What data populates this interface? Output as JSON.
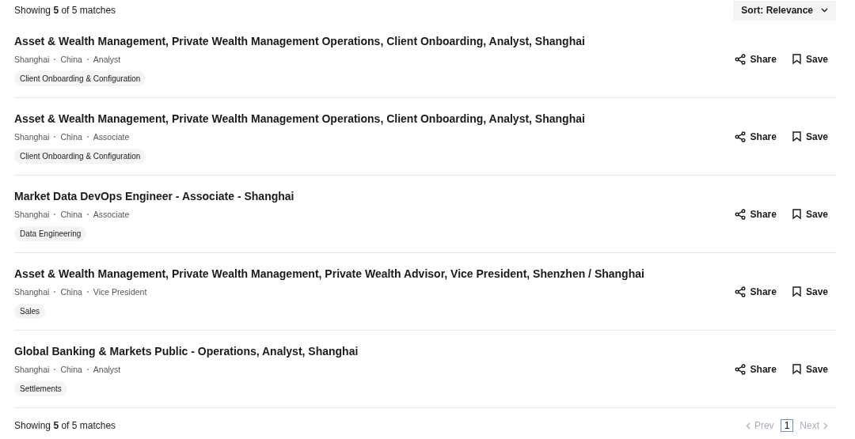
{
  "header": {
    "summary": "Showing **5** of 5 matches",
    "sort": "Sort: Relevance"
  },
  "jobs": [
    {
      "title": "Asset & Wealth Management, Private Wealth Management Operations, Client Onboarding, Analyst, Shanghai",
      "meta": [
        "Shanghai",
        "China",
        "Analyst"
      ],
      "tag": "Client Onboarding & Configuration",
      "share": "Share",
      "save": "Save"
    },
    {
      "title": "Asset & Wealth Management, Private Wealth Management Operations, Client Onboarding, Analyst, Shanghai",
      "meta": [
        "Shanghai",
        "China",
        "Associate"
      ],
      "tag": "Client Onboarding & Configuration",
      "share": "Share",
      "save": "Save"
    },
    {
      "title": "Market Data DevOps Engineer - Associate - Shanghai",
      "meta": [
        "Shanghai",
        "China",
        "Associate"
      ],
      "tag": "Data Engineering",
      "share": "Share",
      "save": "Save"
    },
    {
      "title": "Asset & Wealth Management, Private Wealth Management, Private Wealth Advisor, Vice President, Shenzhen / Shanghai",
      "meta": [
        "Shanghai",
        "China",
        "Vice President"
      ],
      "tag": "Sales",
      "share": "Share",
      "save": "Save"
    },
    {
      "title": "Global Banking & Markets Public - Operations, Analyst, Shanghai",
      "meta": [
        "Shanghai",
        "China",
        "Analyst"
      ],
      "tag": "Settlements",
      "share": "Share",
      "save": "Save"
    }
  ],
  "footer": {
    "summary": "Showing **5** of 5 matches",
    "prev": {
      "label": "Prev",
      "disabled": true
    },
    "pages": [
      {
        "label": "1",
        "selected": true
      }
    ],
    "next": {
      "label": "Next",
      "disabled": true
    }
  }
}
